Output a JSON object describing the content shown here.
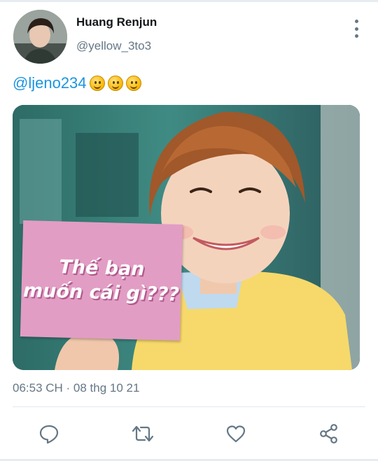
{
  "tweet": {
    "author_name": "Huang Renjun",
    "author_handle": "@yellow_3to3",
    "text": "@ljeno234",
    "emojis": [
      "slightly-smiling-face",
      "slightly-smiling-face",
      "slightly-smiling-face"
    ],
    "image_caption_line1": "Thế bạn",
    "image_caption_line2": "muốn cái gì???",
    "timestamp": "06:53 CH · 08 thg 10 21"
  },
  "actions": [
    "reply-icon",
    "retweet-icon",
    "like-icon",
    "share-icon"
  ],
  "colors": {
    "link": "#1b95e0",
    "secondary_text": "#657786",
    "sign_pink": "#e29dc4",
    "sweater_yellow": "#f6d96a"
  }
}
